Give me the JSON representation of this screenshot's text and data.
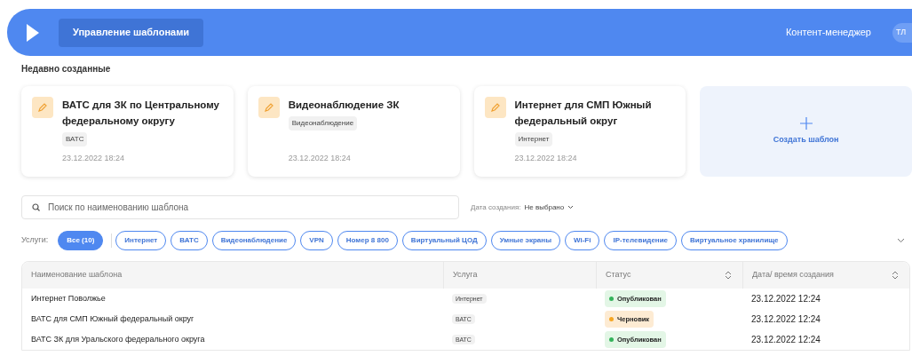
{
  "header": {
    "nav_button": "Управление шаблонами",
    "role": "Контент-менеджер",
    "avatar": "ТЛ"
  },
  "recent": {
    "title": "Недавно созданные",
    "cards": [
      {
        "title": "ВАТС для ЗК по Центральному федеральному округу",
        "tag": "ВАТС",
        "date": "23.12.2022 18:24"
      },
      {
        "title": "Видеонаблюдение ЗК",
        "tag": "Видеонаблюдение",
        "date": "23.12.2022 18:24"
      },
      {
        "title": "Интернет для СМП Южный федеральный округ",
        "tag": "Интернет",
        "date": "23.12.2022 18:24"
      }
    ],
    "create_label": "Создать шаблон"
  },
  "search": {
    "placeholder": "Поиск по наименованию шаблона"
  },
  "date_filter": {
    "label": "Дата создания:",
    "value": "Не выбрано"
  },
  "services": {
    "label": "Услуги:",
    "chips": [
      {
        "label": "Все (10)",
        "selected": true
      },
      {
        "label": "Интернет",
        "selected": false
      },
      {
        "label": "ВАТС",
        "selected": false
      },
      {
        "label": "Видеонаблюдение",
        "selected": false
      },
      {
        "label": "VPN",
        "selected": false
      },
      {
        "label": "Номер 8 800",
        "selected": false
      },
      {
        "label": "Виртуальный ЦОД",
        "selected": false
      },
      {
        "label": "Умные экраны",
        "selected": false
      },
      {
        "label": "Wi-Fi",
        "selected": false
      },
      {
        "label": "IP-телевидение",
        "selected": false
      },
      {
        "label": "Виртуальное хранилище",
        "selected": false
      }
    ]
  },
  "table": {
    "columns": [
      {
        "label": "Наименование шаблона",
        "sortable": false
      },
      {
        "label": "Услуга",
        "sortable": false
      },
      {
        "label": "Статус",
        "sortable": true
      },
      {
        "label": "Дата/ время создания",
        "sortable": true
      }
    ],
    "rows": [
      {
        "name": "Интернет Поволжье",
        "service": "Интернет",
        "status": "Опубликован",
        "kind": "published",
        "date": "23.12.2022 12:24"
      },
      {
        "name": "ВАТС для СМП Южный федеральный округ",
        "service": "ВАТС",
        "status": "Черновик",
        "kind": "draft",
        "date": "23.12.2022 12:24"
      },
      {
        "name": "ВАТС ЗК для Уральского федерального округа",
        "service": "ВАТС",
        "status": "Опубликован",
        "kind": "published",
        "date": "23.12.2022 12:24"
      }
    ]
  }
}
